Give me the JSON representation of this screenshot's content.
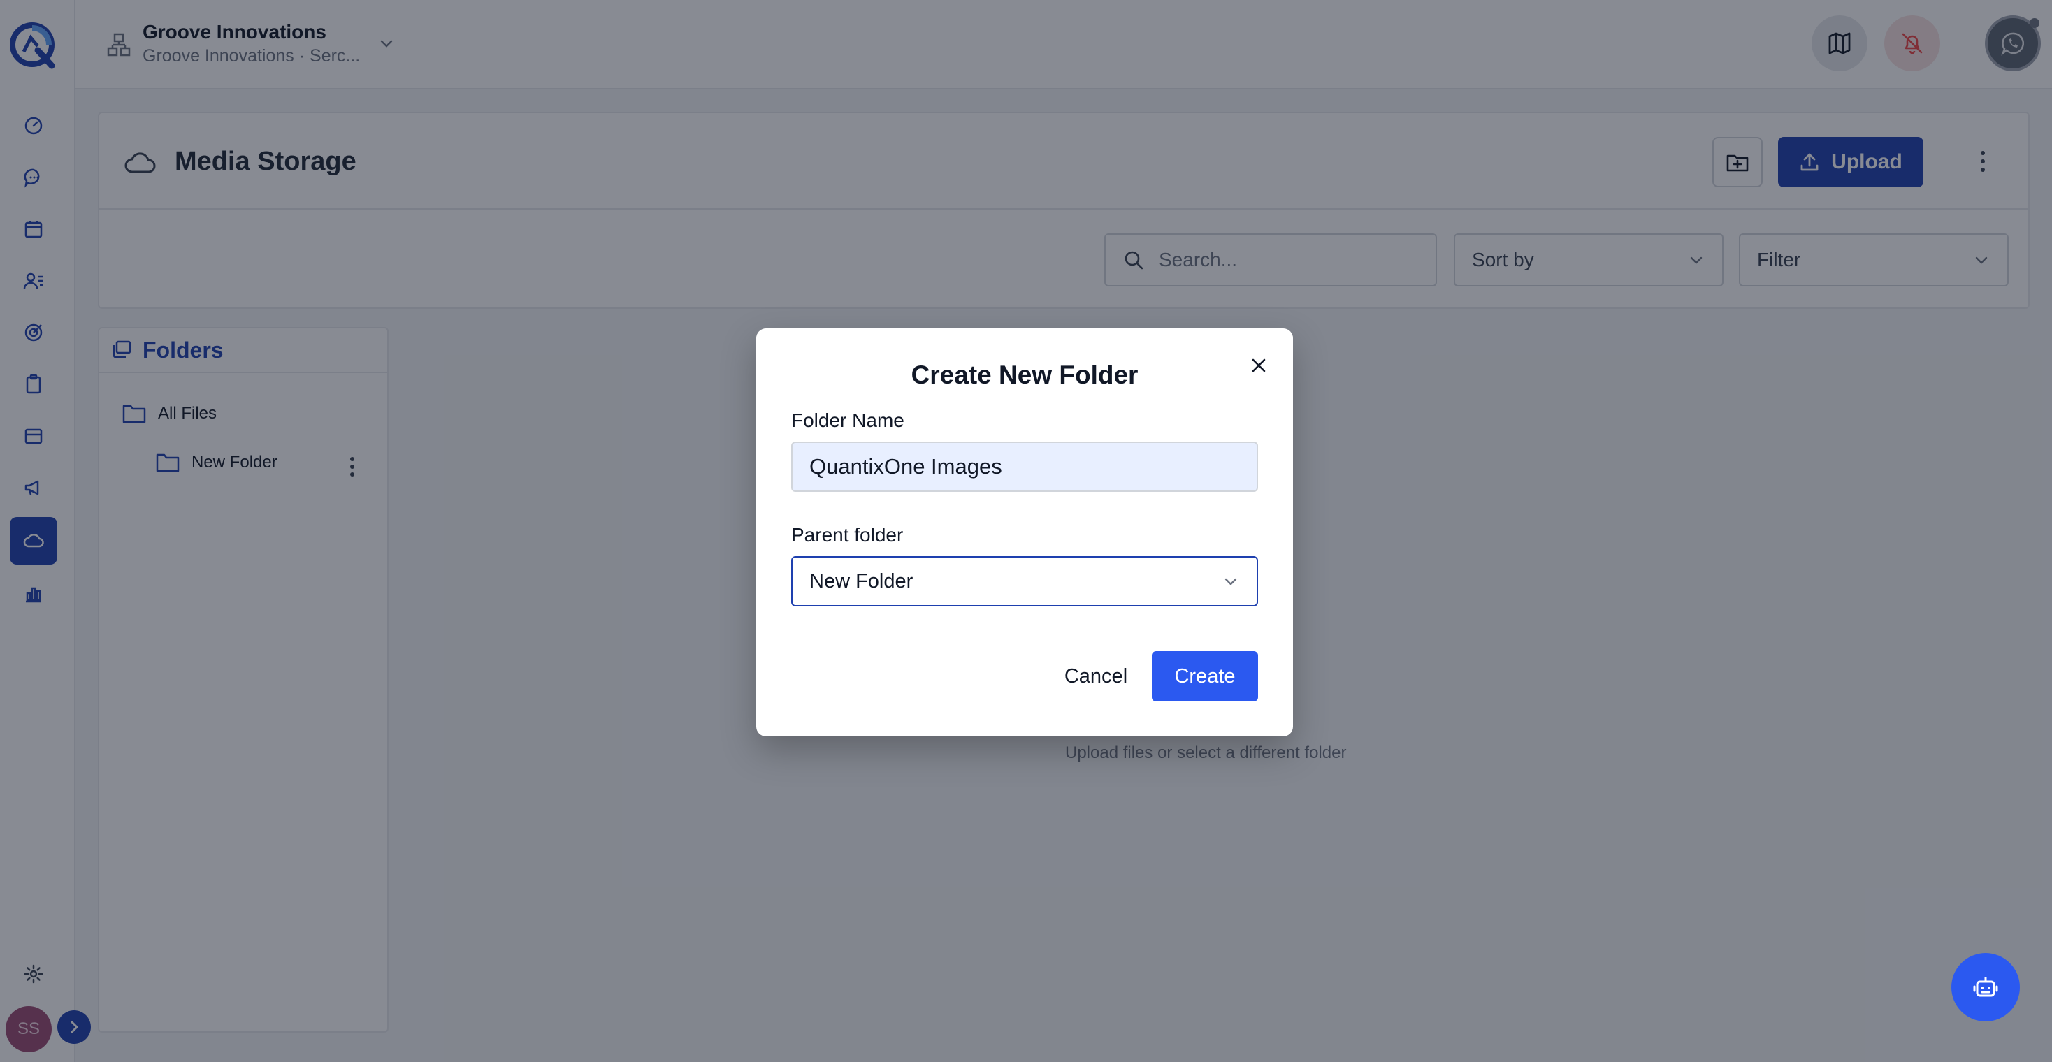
{
  "header": {
    "org_title": "Groove Innovations",
    "org_subtitle": "Groove Innovations · Serc...",
    "avatar_initials": "SS"
  },
  "sidebar": {
    "items": [
      {
        "icon": "dashboard-gauge-icon"
      },
      {
        "icon": "chat-bubble-icon"
      },
      {
        "icon": "calendar-icon"
      },
      {
        "icon": "contacts-list-icon"
      },
      {
        "icon": "target-icon"
      },
      {
        "icon": "clipboard-icon"
      },
      {
        "icon": "inbox-tray-icon"
      },
      {
        "icon": "megaphone-icon"
      },
      {
        "icon": "cloud-icon",
        "active": true
      },
      {
        "icon": "bar-chart-icon"
      }
    ],
    "avatar_initials": "SS"
  },
  "media": {
    "title": "Media Storage",
    "upload_label": "Upload",
    "search_placeholder": "Search...",
    "sort_label": "Sort by",
    "filter_label": "Filter",
    "empty_text": "Upload files or select a different folder"
  },
  "folders": {
    "title": "Folders",
    "items": [
      {
        "label": "All Files"
      },
      {
        "label": "New Folder"
      }
    ]
  },
  "modal": {
    "title": "Create New Folder",
    "folder_name_label": "Folder Name",
    "folder_name_value": "QuantixOne Images",
    "parent_label": "Parent folder",
    "parent_value": "New Folder",
    "cancel_label": "Cancel",
    "create_label": "Create"
  },
  "colors": {
    "primary": "#1e40af",
    "create_button": "#2b59f0",
    "avatar": "#9b4a73"
  }
}
